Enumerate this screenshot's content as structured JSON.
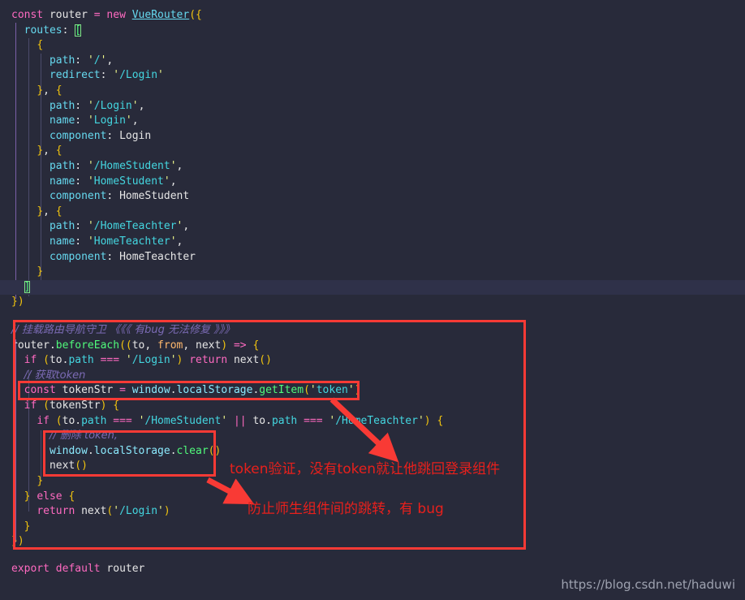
{
  "editor": {
    "background": "#282a3a",
    "highlight_line_background": "#2f3149",
    "font_size_px": 13,
    "code_top": [
      {
        "indent": 0,
        "text": "const router = new VueRouter({"
      },
      {
        "indent": 1,
        "text": "routes: ["
      },
      {
        "indent": 2,
        "text": "{"
      },
      {
        "indent": 3,
        "text": "path: '/',"
      },
      {
        "indent": 3,
        "text": "redirect: '/Login'"
      },
      {
        "indent": 2,
        "text": "}, {"
      },
      {
        "indent": 3,
        "text": "path: '/Login',"
      },
      {
        "indent": 3,
        "text": "name: 'Login',"
      },
      {
        "indent": 3,
        "text": "component: Login"
      },
      {
        "indent": 2,
        "text": "}, {"
      },
      {
        "indent": 3,
        "text": "path: '/HomeStudent',"
      },
      {
        "indent": 3,
        "text": "name: 'HomeStudent',"
      },
      {
        "indent": 3,
        "text": "component: HomeStudent"
      },
      {
        "indent": 2,
        "text": "}, {"
      },
      {
        "indent": 3,
        "text": "path: '/HomeTeachter',"
      },
      {
        "indent": 3,
        "text": "name: 'HomeTeachter',"
      },
      {
        "indent": 3,
        "text": "component: HomeTeachter"
      },
      {
        "indent": 2,
        "text": "}"
      },
      {
        "indent": 1,
        "text": "]"
      },
      {
        "indent": 0,
        "text": "})"
      }
    ],
    "code_guard": [
      {
        "text": "// 挂载路由导航守卫 《《《 有bug 无法修复 》》》"
      },
      {
        "text": "router.beforeEach((to, from, next) => {"
      },
      {
        "text": "if (to.path === '/Login') return next()"
      },
      {
        "text": "// 获取token"
      },
      {
        "text": "const tokenStr = window.localStorage.getItem('token')"
      },
      {
        "text": "if (tokenStr) {"
      },
      {
        "text": "if (to.path === '/HomeStudent' || to.path === '/HomeTeachter') {"
      },
      {
        "text": "// 删除 token,"
      },
      {
        "text": "window.localStorage.clear()"
      },
      {
        "text": "next()"
      },
      {
        "text": "}"
      },
      {
        "text": "} else {"
      },
      {
        "text": "return next('/Login')"
      },
      {
        "text": "}"
      },
      {
        "text": "})"
      }
    ],
    "code_footer": [
      {
        "text": "export default router"
      }
    ]
  },
  "annotations": {
    "box_color": "#f93a35",
    "text_color": "#e8201c",
    "outer_box_label": "navigation-guard-block",
    "inner_box_1_label": "get-token-line",
    "inner_box_2_label": "clear-token-block",
    "note_1": "token验证，没有token就让他跳回登录组件",
    "note_2": "防止师生组件间的跳转，有 bug"
  },
  "watermark": {
    "text": "https://blog.csdn.net/haduwi"
  },
  "tokens": {
    "kw_const": "const",
    "kw_new": "new",
    "kw_if": "if",
    "kw_else": "else",
    "kw_return": "return",
    "kw_export": "export",
    "kw_default": "default",
    "id_router": "router",
    "id_VueRouter": "VueRouter",
    "key_routes": "routes",
    "key_path": "path",
    "key_redirect": "redirect",
    "key_name": "name",
    "key_component": "component",
    "v_login": "Login",
    "v_homestudent": "HomeStudent",
    "v_hometeachter": "HomeTeachter",
    "s_root": "'/'",
    "s_login": "'/Login'",
    "s_homestudent": "'/HomeStudent'",
    "s_hometeachter": "'/HomeTeachter'",
    "s_token": "'token'",
    "m_beforeEach": "beforeEach",
    "m_getItem": "getItem",
    "m_clear": "clear",
    "o_window": "window",
    "o_localStorage": "localStorage",
    "id_to": "to",
    "id_from": "from",
    "id_next": "next",
    "id_tokenStr": "tokenStr",
    "op_eq3": "===",
    "op_or": "||",
    "op_arrow": "=>",
    "op_assign": "="
  }
}
